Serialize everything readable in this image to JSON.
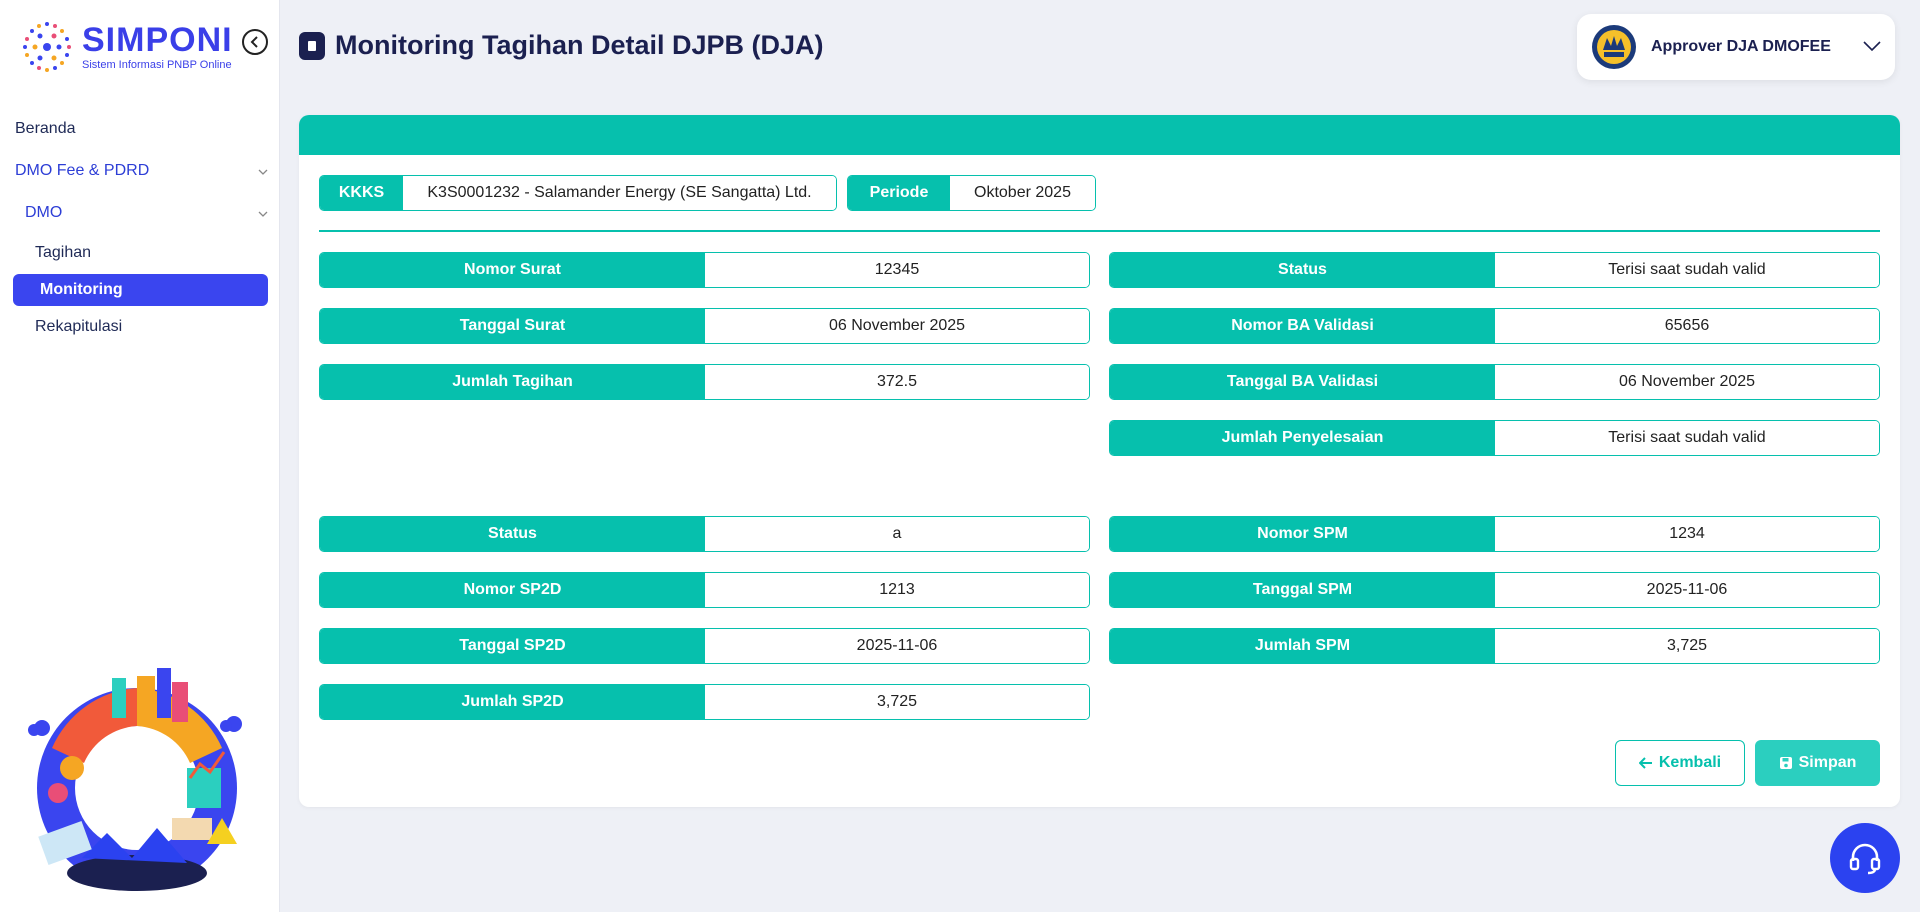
{
  "logo": {
    "title": "SIMPONI",
    "subtitle": "Sistem Informasi PNBP Online"
  },
  "sidebar": {
    "items": [
      {
        "label": "Beranda"
      },
      {
        "label": "DMO Fee & PDRD"
      },
      {
        "label": "DMO"
      },
      {
        "label": "Tagihan"
      },
      {
        "label": "Monitoring"
      },
      {
        "label": "Rekapitulasi"
      }
    ]
  },
  "header": {
    "title": "Monitoring Tagihan Detail DJPB (DJA)"
  },
  "user": {
    "name": "Approver DJA DMOFEE"
  },
  "summary": {
    "kkks_label": "KKKS",
    "kkks_value": "K3S0001232 - Salamander Energy (SE Sangatta) Ltd.",
    "periode_label": "Periode",
    "periode_value": "Oktober 2025"
  },
  "left_top": [
    {
      "label": "Nomor Surat",
      "value": "12345"
    },
    {
      "label": "Tanggal Surat",
      "value": "06 November 2025"
    },
    {
      "label": "Jumlah Tagihan",
      "value": "372.5"
    }
  ],
  "right_top": [
    {
      "label": "Status",
      "value": "Terisi saat sudah valid"
    },
    {
      "label": "Nomor BA Validasi",
      "value": "65656"
    },
    {
      "label": "Tanggal BA Validasi",
      "value": "06 November 2025"
    },
    {
      "label": "Jumlah Penyelesaian",
      "value": "Terisi saat sudah valid"
    }
  ],
  "left_bottom": [
    {
      "label": "Status",
      "value": "a"
    },
    {
      "label": "Nomor SP2D",
      "value": "1213"
    },
    {
      "label": "Tanggal SP2D",
      "value": "2025-11-06"
    },
    {
      "label": "Jumlah SP2D",
      "value": "3,725"
    }
  ],
  "right_bottom": [
    {
      "label": "Nomor SPM",
      "value": "1234"
    },
    {
      "label": "Tanggal SPM",
      "value": "2025-11-06"
    },
    {
      "label": "Jumlah SPM",
      "value": "3,725"
    }
  ],
  "actions": {
    "back_label": "Kembali",
    "save_label": "Simpan"
  },
  "colors": {
    "accent": "#06c0ad",
    "primary": "#3a45ef",
    "title": "#1b2050"
  },
  "icons": {
    "collapse": "chevron-left-icon",
    "back": "arrow-left-icon",
    "save": "save-icon",
    "help": "headset-icon"
  }
}
